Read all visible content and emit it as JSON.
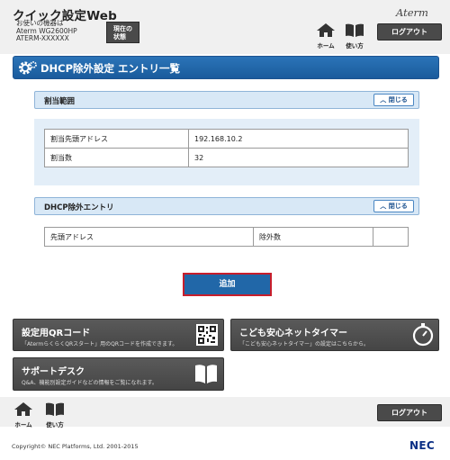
{
  "header": {
    "app_title": "クイック設定Web",
    "model_caption": "お使いの機器は",
    "model_name": "Aterm WG2600HP",
    "model_id": "ATERM-XXXXXX",
    "status_button": [
      "現在の",
      "状態"
    ],
    "logo": "Aterm",
    "nav_home": "ホーム",
    "nav_guide": "使い方",
    "logout": "ログアウト"
  },
  "page": {
    "title": "DHCP除外設定 エントリ一覧"
  },
  "assigned_range": {
    "heading": "割当範囲",
    "close": "閉じる",
    "rows": [
      {
        "label": "割当先頭アドレス",
        "value": "192.168.10.2"
      },
      {
        "label": "割当数",
        "value": "32"
      }
    ]
  },
  "exclusion_entries": {
    "heading": "DHCP除外エントリ",
    "close": "閉じる",
    "columns": [
      "先頭アドレス",
      "除外数",
      ""
    ]
  },
  "actions": {
    "add": "追加"
  },
  "tiles": {
    "qr": {
      "title": "設定用QRコード",
      "desc": "「AtermらくらくQRスタート」用のQRコードを作成できます。"
    },
    "kids": {
      "title": "こども安心ネットタイマー",
      "desc": "「こども安心ネットタイマー」の設定はこちらから。"
    },
    "support": {
      "title": "サポートデスク",
      "desc": "Q&A、機能別設定ガイドなどの情報をご覧になれます。"
    }
  },
  "footer": {
    "nav_home": "ホーム",
    "nav_guide": "使い方",
    "logout": "ログアウト",
    "copyright": "Copyright© NEC Platforms, Ltd. 2001-2015",
    "brand": "NEC"
  },
  "colors": {
    "title_bar": "#2167a8",
    "panel_bg": "#e3eef8",
    "add_border": "#c81e2c",
    "tile_bg": "#4f4f4f"
  }
}
